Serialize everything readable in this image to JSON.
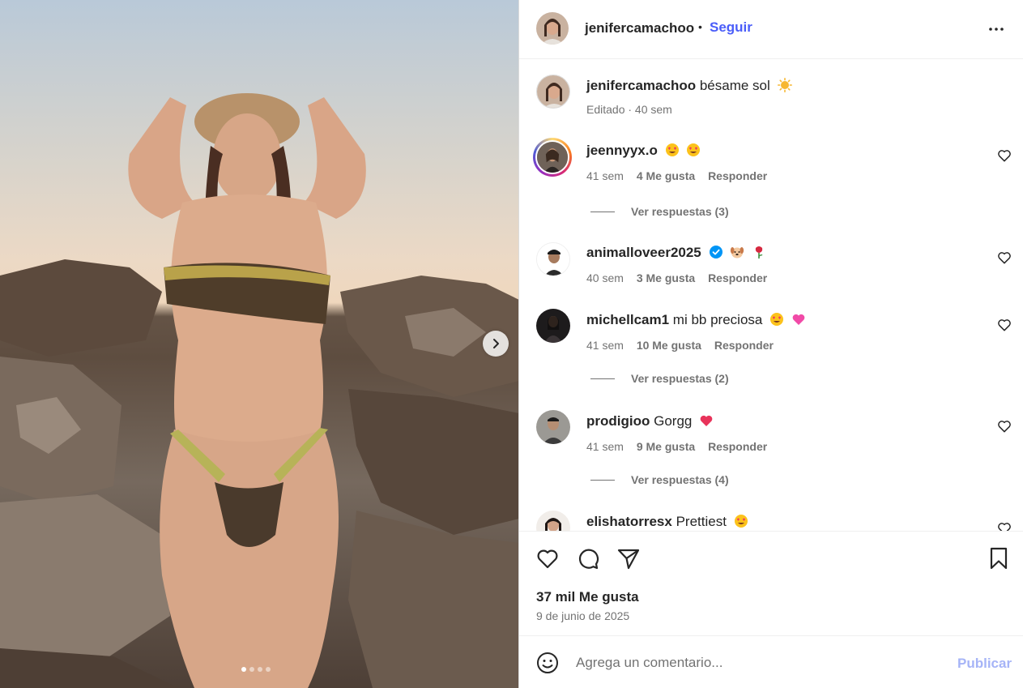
{
  "post": {
    "author": "jenifercamachoo",
    "separator": "•",
    "follow_label": "Seguir",
    "more_icon": "more-horizontal-icon",
    "carousel_count": 4,
    "carousel_active_index": 0
  },
  "caption": {
    "username": "jenifercamachoo",
    "text": "bésame sol",
    "emoji": "sun",
    "meta": "Editado · 40 sem"
  },
  "comments": [
    {
      "username": "jeennyyx.o",
      "text": "",
      "emojis": [
        "heart-eyes",
        "heart-eyes"
      ],
      "time": "41 sem",
      "likes": "4 Me gusta",
      "reply": "Responder",
      "replies_label": "Ver respuestas (3)",
      "story_ring": true
    },
    {
      "username": "animalloveer2025",
      "verified": true,
      "text": "",
      "emojis": [
        "dog",
        "rose"
      ],
      "time": "40 sem",
      "likes": "3 Me gusta",
      "reply": "Responder",
      "replies_label": ""
    },
    {
      "username": "michellcam1",
      "text": "mi bb preciosa",
      "emojis": [
        "heart-eyes",
        "pink-heart"
      ],
      "time": "41 sem",
      "likes": "10 Me gusta",
      "reply": "Responder",
      "replies_label": "Ver respuestas (2)"
    },
    {
      "username": "prodigioo",
      "text": "Gorgg",
      "emojis": [
        "red-heart"
      ],
      "time": "41 sem",
      "likes": "9 Me gusta",
      "reply": "Responder",
      "replies_label": "Ver respuestas (4)"
    },
    {
      "username": "elishatorresx",
      "text": "Prettiest",
      "emojis": [
        "heart-eyes"
      ],
      "time": "",
      "likes": "",
      "reply": "",
      "replies_label": ""
    }
  ],
  "actions": {
    "likes_label": "37 mil Me gusta",
    "date": "9 de junio de 2025"
  },
  "composer": {
    "placeholder": "Agrega un comentario...",
    "publish_label": "Publicar"
  },
  "colors": {
    "link_blue": "#4a5df9",
    "publish_disabled": "#a6b4f7",
    "muted": "#737373",
    "verified": "#0095f6"
  }
}
